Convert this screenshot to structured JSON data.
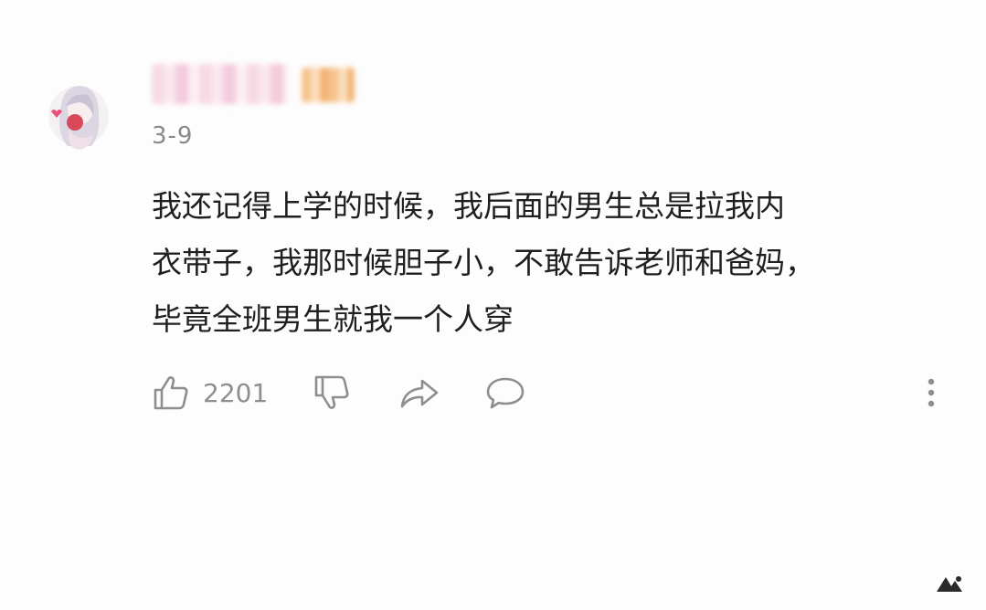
{
  "comment": {
    "date": "3-9",
    "lines": [
      "我还记得上学的时候，我后面的男生总是拉我内",
      "衣带子，我那时候胆子小，不敢告诉老师和爸妈，",
      "毕竟全班男生就我一个人穿"
    ],
    "like_count": "2201"
  },
  "icons": {
    "like": "thumbs-up-icon",
    "dislike": "thumbs-down-icon",
    "share": "share-arrow-icon",
    "reply": "chat-bubble-icon",
    "more": "vertical-ellipsis-icon"
  },
  "colors": {
    "text": "#1f1f1f",
    "muted": "#8a8a8a",
    "icon": "#8e8e8e",
    "background": "#fdfdfd"
  }
}
